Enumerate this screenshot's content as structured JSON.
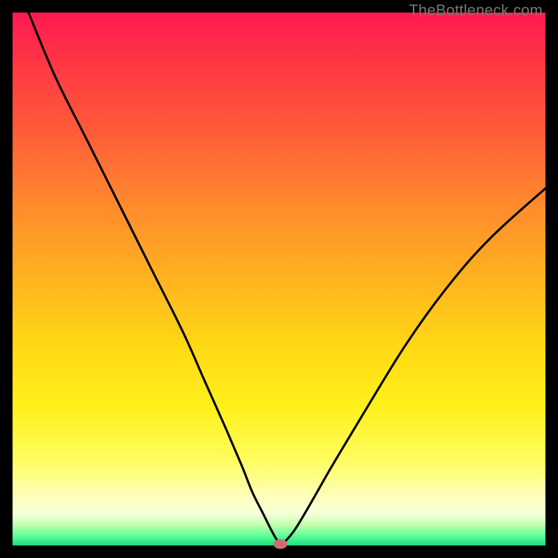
{
  "watermark": "TheBottleneck.com",
  "colors": {
    "frame": "#000000",
    "curve_stroke": "#000000",
    "marker_fill": "#cc6e6e",
    "gradient_stops": [
      "#ff1a52",
      "#ff3545",
      "#ff5a3a",
      "#ff8a2d",
      "#ffb31f",
      "#ffd915",
      "#fff01a",
      "#fffd60",
      "#ffffbd",
      "#f5ffd9",
      "#c7ffb0",
      "#66ff99",
      "#18e080"
    ]
  },
  "chart_data": {
    "type": "line",
    "title": "",
    "xlabel": "",
    "ylabel": "",
    "xlim": [
      0,
      100
    ],
    "ylim": [
      0,
      100
    ],
    "grid": false,
    "series": [
      {
        "name": "bottleneck-curve",
        "x": [
          3,
          8,
          14,
          20,
          26,
          32,
          36,
          40,
          43,
          45,
          47,
          48.5,
          49.5,
          50.3,
          51,
          53,
          56,
          60,
          66,
          74,
          82,
          90,
          100
        ],
        "y": [
          100,
          88,
          76,
          64,
          52,
          40,
          31,
          22,
          15,
          10,
          6,
          3,
          1.2,
          0.2,
          0.6,
          3,
          8,
          15,
          25,
          38,
          49,
          58,
          67
        ]
      }
    ],
    "annotations": [
      {
        "name": "min-marker",
        "x": 50.3,
        "y": 0.2
      }
    ]
  }
}
